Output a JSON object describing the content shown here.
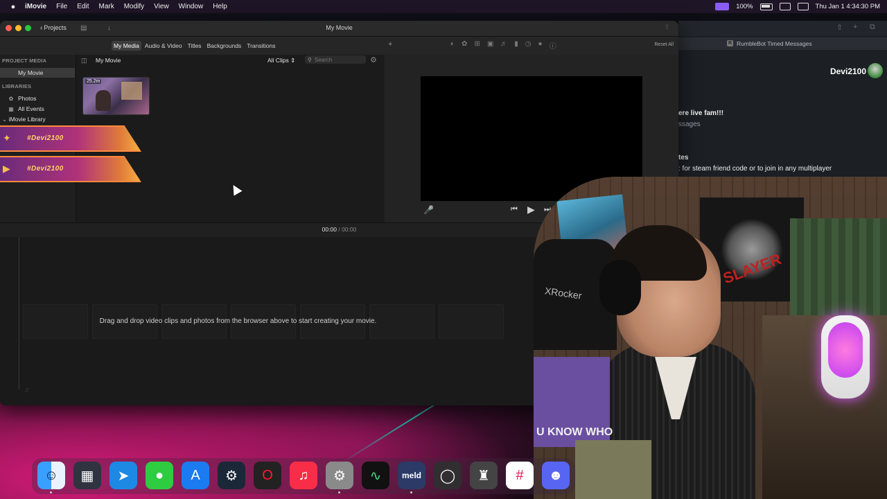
{
  "menubar": {
    "apple": "",
    "app": "iMovie",
    "items": [
      "File",
      "Edit",
      "Mark",
      "Modify",
      "View",
      "Window",
      "Help"
    ],
    "battery": "100%",
    "clock": "Thu Jan 1  4:34:30 PM"
  },
  "window": {
    "projects_label": "Projects",
    "title": "My Movie",
    "tabs": [
      "My Media",
      "Audio & Video",
      "Titles",
      "Backgrounds",
      "Transitions"
    ],
    "active_tab": "My Media",
    "reset_label": "Reset All"
  },
  "sidebar": {
    "project_media_header": "PROJECT MEDIA",
    "project_item": "My Movie",
    "libraries_header": "LIBRARIES",
    "items": [
      "Photos",
      "All Events",
      "iMovie Library"
    ]
  },
  "browser": {
    "title": "My Movie",
    "filter": "All Clips",
    "search_placeholder": "Search",
    "clip_duration": "25.2m"
  },
  "overlay": {
    "banner_text": "#Devi2100"
  },
  "timecode": {
    "current": "00:00",
    "separator": "/",
    "total": "00:00"
  },
  "timeline": {
    "message": "Drag and drop video clips and photos from the browser above to start creating your movie."
  },
  "chat": {
    "tab_title": "RumbleBot Timed Messages",
    "username": "Devi2100",
    "lines": [
      "ere live fam!!!",
      "ssages",
      "tes",
      ": for steam friend code or to join in any multiplayer"
    ]
  },
  "webcam": {
    "chair_brand": "XRocker",
    "band": "SLAYER",
    "box_text": "U KNOW WHO"
  },
  "dock": {
    "apps": [
      "Finder",
      "Launchpad",
      "Safari",
      "Messages",
      "App Store",
      "Steam",
      "Opera",
      "Music",
      "System Settings",
      "Activity Monitor",
      "Meld",
      "OBS",
      "Migration",
      "Slack",
      "Discord"
    ],
    "meld_label": "meld"
  },
  "colors": {
    "accent_purple": "#8b5cf6",
    "banner_gold": "#ffd36a",
    "traffic_red": "#ff5f57",
    "traffic_yellow": "#febc2e",
    "traffic_green": "#28c840"
  }
}
